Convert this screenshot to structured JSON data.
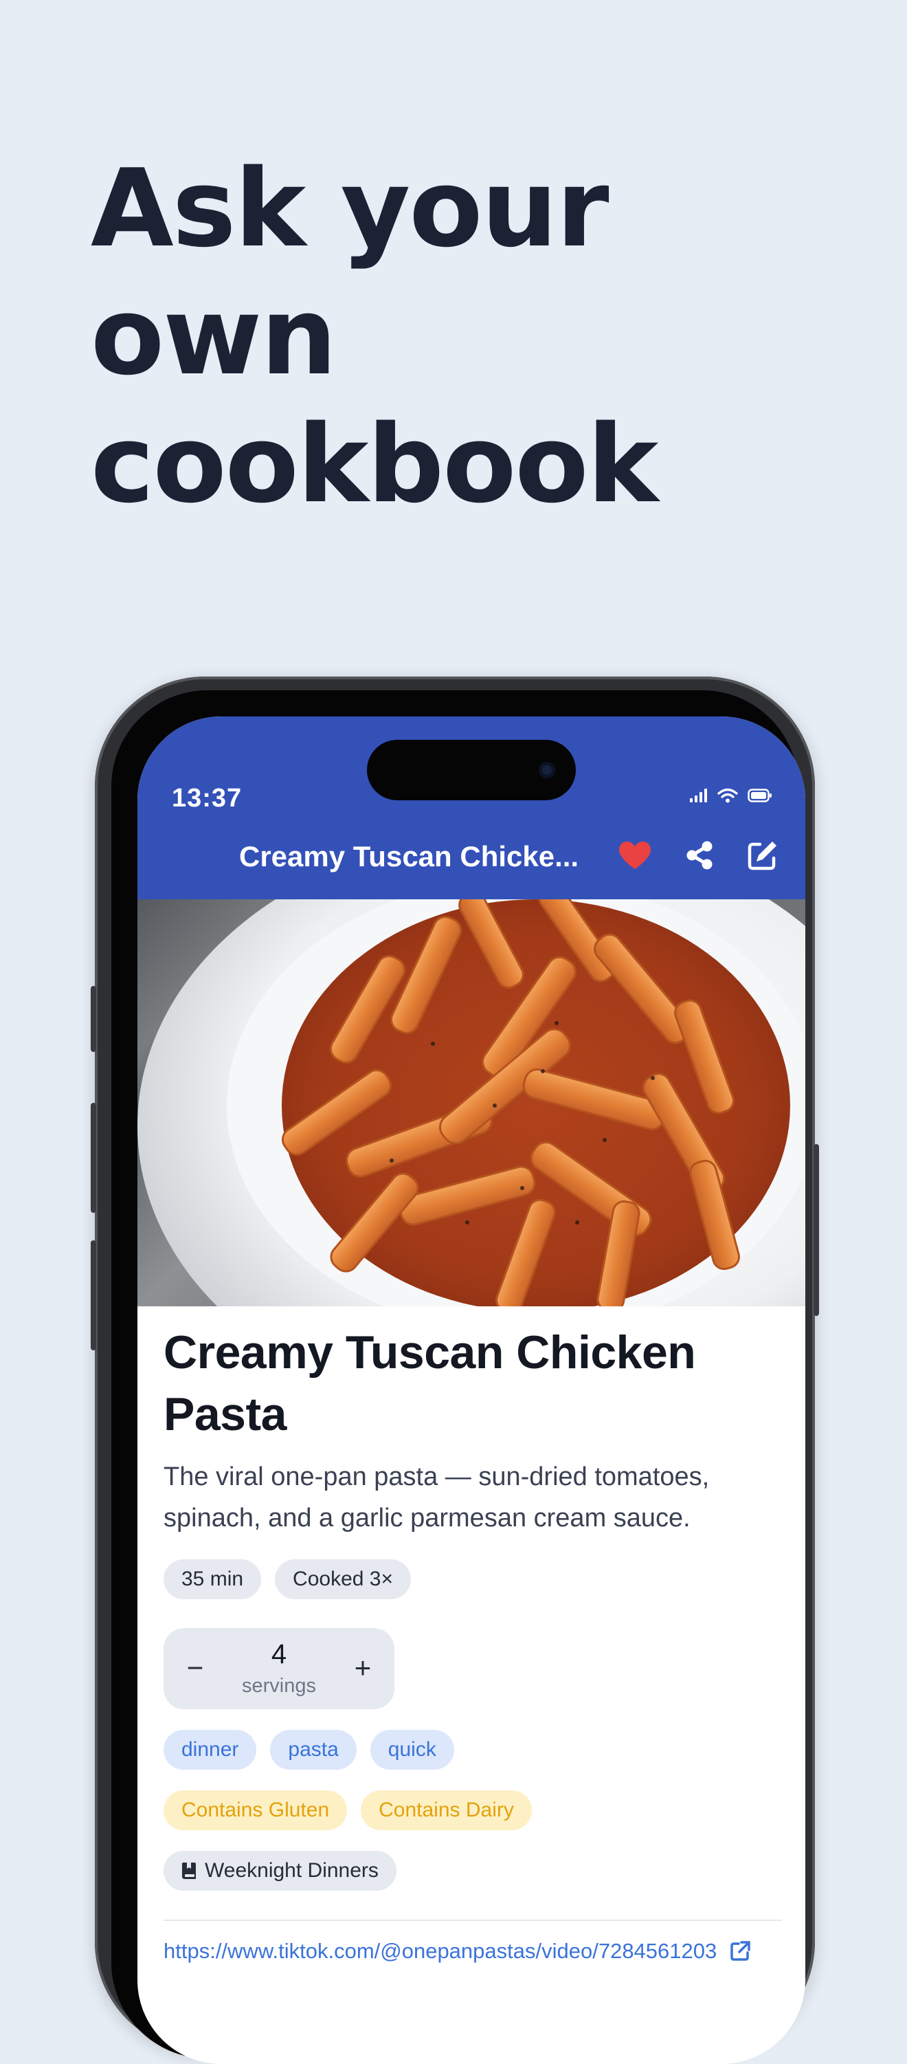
{
  "marketing": {
    "headline_line1": "Ask your",
    "headline_line2": "own",
    "headline_line3": "cookbook"
  },
  "status_bar": {
    "time": "13:37"
  },
  "nav": {
    "title": "Creamy Tuscan Chicke...",
    "favorite_icon": "heart-icon",
    "share_icon": "share-icon",
    "edit_icon": "edit-icon"
  },
  "recipe": {
    "title": "Creamy Tuscan Chicken Pasta",
    "description": "The viral one-pan pasta — sun-dried tomatoes, spinach, and a garlic parmesan cream sauce.",
    "meta": [
      "35 min",
      "Cooked 3×"
    ],
    "servings": {
      "count": "4",
      "unit": "servings",
      "minus": "−",
      "plus": "+"
    },
    "tags": [
      "dinner",
      "pasta",
      "quick"
    ],
    "allergens": [
      "Contains Gluten",
      "Contains Dairy"
    ],
    "collection": "Weeknight Dinners",
    "source_url": "https://www.tiktok.com/@onepanpastas/video/7284561203"
  },
  "colors": {
    "background": "#E6EDF5",
    "headline": "#1A2234",
    "topbar": "#3451B8",
    "heart": "#EA4141",
    "tag_blue_text": "#3A73D9",
    "tag_blue_bg": "#DCE7FB",
    "allergen_text": "#E3A20D",
    "allergen_bg": "#FDF0C4",
    "chip_gray_bg": "#E6E9EF"
  }
}
